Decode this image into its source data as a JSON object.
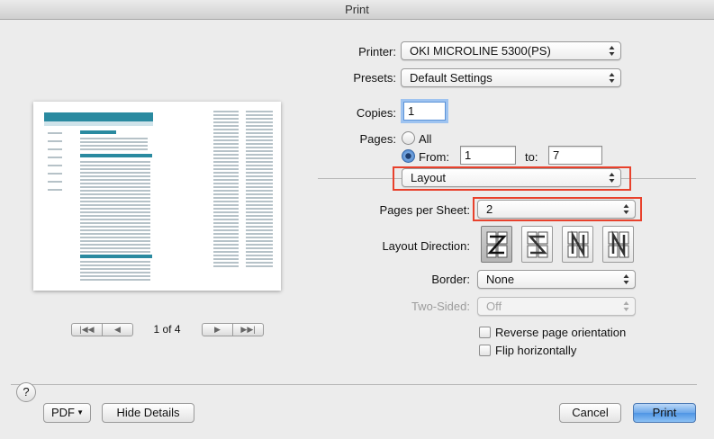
{
  "window": {
    "title": "Print"
  },
  "printer": {
    "label": "Printer:",
    "value": "OKI MICROLINE 5300(PS)"
  },
  "presets": {
    "label": "Presets:",
    "value": "Default Settings"
  },
  "copies": {
    "label": "Copies:",
    "value": "1"
  },
  "pages": {
    "label": "Pages:",
    "all_label": "All",
    "from_label": "From:",
    "from_value": "1",
    "to_label": "to:",
    "to_value": "7",
    "selected": "from"
  },
  "section": {
    "value": "Layout"
  },
  "pages_per_sheet": {
    "label": "Pages per Sheet:",
    "value": "2"
  },
  "layout_direction": {
    "label": "Layout Direction:",
    "options": [
      "z-left-right",
      "s-right-left",
      "n-reverse-top-bottom",
      "n-top-bottom"
    ],
    "selected": "z-left-right"
  },
  "border": {
    "label": "Border:",
    "value": "None"
  },
  "two_sided": {
    "label": "Two-Sided:",
    "value": "Off",
    "disabled": true
  },
  "reverse_orientation": {
    "label": "Reverse page orientation",
    "checked": false
  },
  "flip_horizontally": {
    "label": "Flip horizontally",
    "checked": false
  },
  "pager": {
    "status": "1 of 4"
  },
  "footer": {
    "help": "?",
    "pdf": "PDF",
    "hide_details": "Hide Details",
    "cancel": "Cancel",
    "print": "Print"
  },
  "colors": {
    "accent": "#4f95e4",
    "highlight": "#e8412c",
    "preview_header": "#2a8aa0"
  }
}
